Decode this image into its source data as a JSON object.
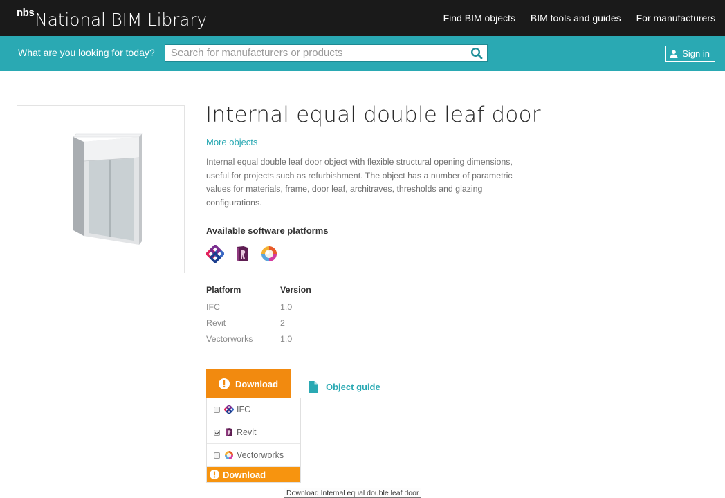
{
  "header": {
    "brand_mark": "nbs",
    "brand_name": "National BIM Library",
    "nav": [
      "Find BIM objects",
      "BIM tools and guides",
      "For manufacturers"
    ]
  },
  "search": {
    "prompt": "What are you looking for today?",
    "placeholder": "Search for manufacturers or products",
    "icon": "search-icon"
  },
  "signin": {
    "label": "Sign in",
    "icon": "user-icon"
  },
  "product": {
    "title": "Internal equal double leaf door",
    "more_link": "More objects",
    "description": "Internal equal double leaf door object with flexible structural opening dimensions, useful for projects such as refurbishment. The object has a number of parametric values for materials, frame, door leaf, architraves, thresholds and glazing configurations.",
    "platforms_heading": "Available software platforms",
    "platform_icons": [
      "ifc-icon",
      "revit-icon",
      "vectorworks-icon"
    ]
  },
  "versions": {
    "headers": [
      "Platform",
      "Version"
    ],
    "rows": [
      [
        "IFC",
        "1.0"
      ],
      [
        "Revit",
        "2"
      ],
      [
        "Vectorworks",
        "1.0"
      ]
    ]
  },
  "download": {
    "button_label": "Download",
    "object_guide": "Object guide",
    "options": [
      {
        "label": "IFC",
        "checked": false
      },
      {
        "label": "Revit",
        "checked": true
      },
      {
        "label": "Vectorworks",
        "checked": false
      }
    ],
    "submit_label": "Download",
    "tooltip": "Download Internal equal double leaf door"
  },
  "colors": {
    "topbar": "#1a1a1a",
    "search_band": "#2aa9b3",
    "accent_link": "#2aa9b3",
    "download_orange": "#f28a0f"
  }
}
